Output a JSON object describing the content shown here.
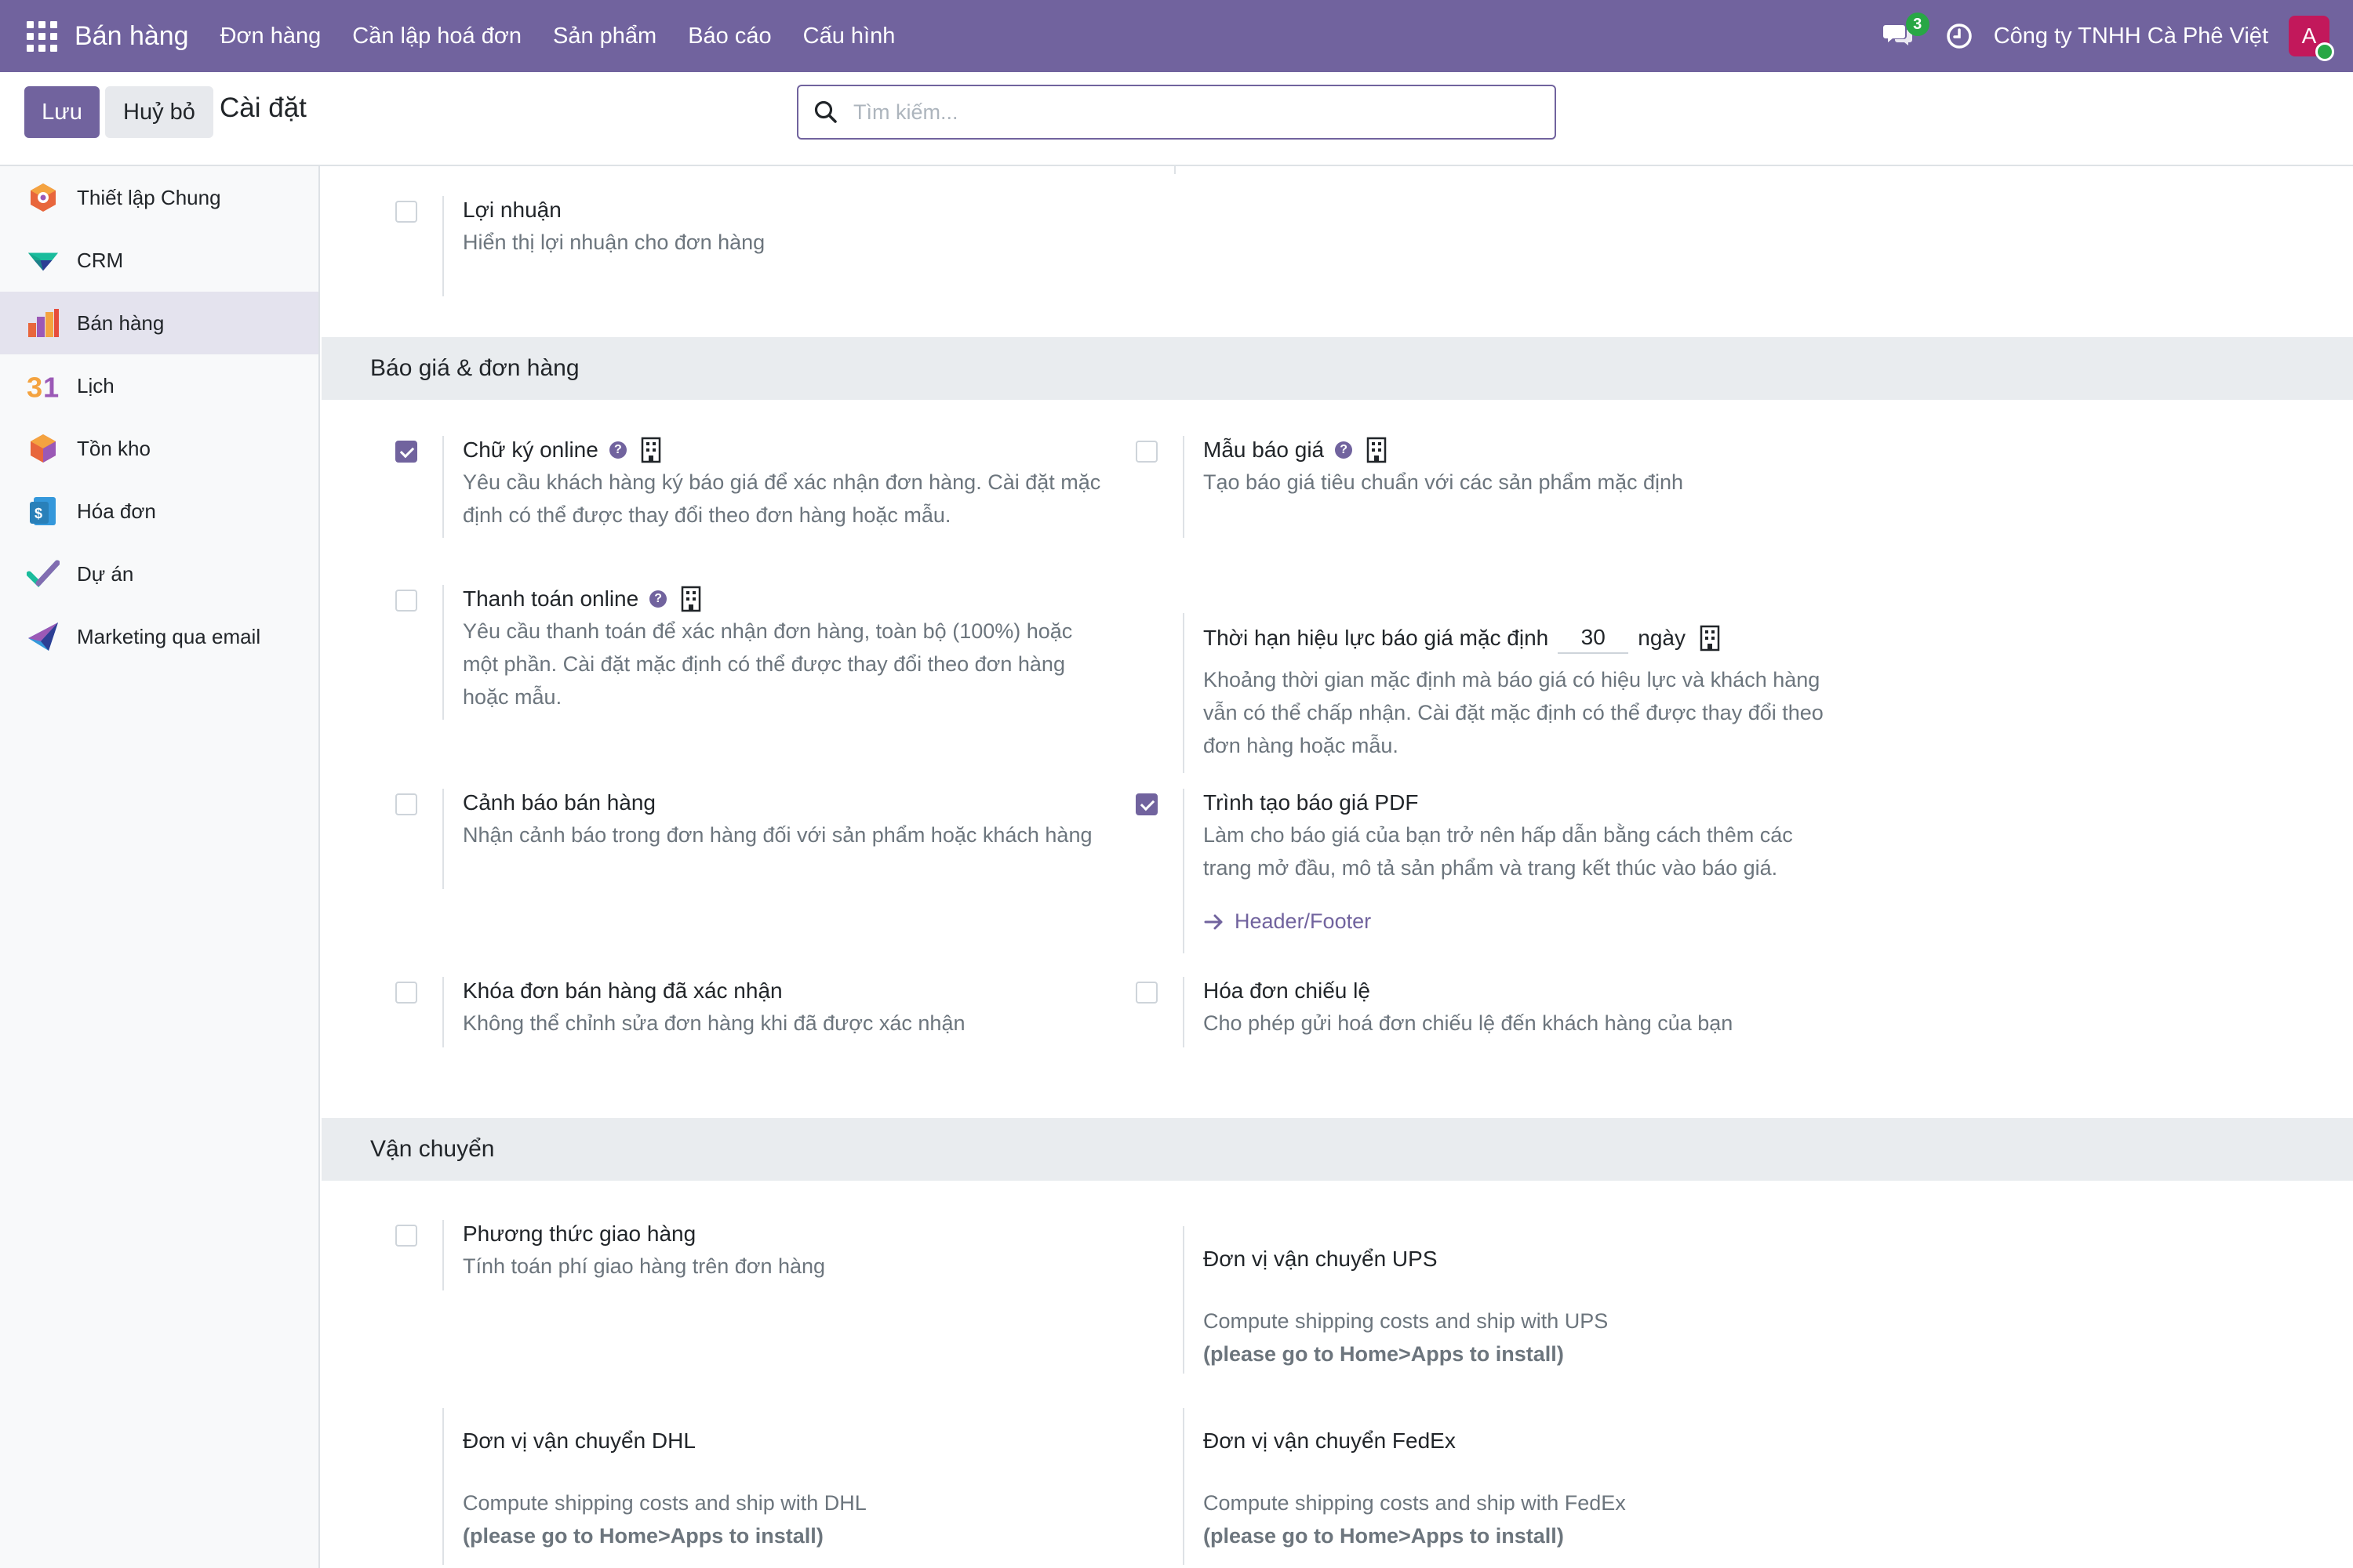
{
  "navbar": {
    "app_name": "Bán hàng",
    "menu": [
      "Đơn hàng",
      "Cần lập hoá đơn",
      "Sản phẩm",
      "Báo cáo",
      "Cấu hình"
    ],
    "chat_count": "3",
    "company": "Công ty TNHH Cà Phê Việt",
    "avatar_letter": "A"
  },
  "control": {
    "save_label": "Lưu",
    "discard_label": "Huỷ bỏ",
    "title": "Cài đặt",
    "search_placeholder": "Tìm kiếm..."
  },
  "sidebar": {
    "items": [
      {
        "label": "Thiết lập Chung",
        "icon": "general-settings-icon"
      },
      {
        "label": "CRM",
        "icon": "crm-icon"
      },
      {
        "label": "Bán hàng",
        "icon": "sales-icon",
        "active": true
      },
      {
        "label": "Lịch",
        "icon": "calendar-icon"
      },
      {
        "label": "Tồn kho",
        "icon": "inventory-icon"
      },
      {
        "label": "Hóa đơn",
        "icon": "invoicing-icon"
      },
      {
        "label": "Dự án",
        "icon": "project-icon"
      },
      {
        "label": "Marketing qua email",
        "icon": "email-marketing-icon"
      }
    ]
  },
  "settings": {
    "margins": {
      "title": "Lợi nhuận",
      "desc": "Hiển thị lợi nhuận cho đơn hàng",
      "checked": false
    },
    "quotations_section": "Báo giá & đơn hàng",
    "online_signature": {
      "title": "Chữ ký online",
      "desc": "Yêu cầu khách hàng ký báo giá để xác nhận đơn hàng. Cài đặt mặc định có thể được thay đổi theo đơn hàng hoặc mẫu.",
      "checked": true
    },
    "quotation_templates": {
      "title": "Mẫu báo giá",
      "desc": "Tạo báo giá tiêu chuẩn với các sản phẩm mặc định",
      "checked": false
    },
    "online_payment": {
      "title": "Thanh toán online",
      "desc": "Yêu cầu thanh toán để xác nhận đơn hàng, toàn bộ (100%) hoặc một phần. Cài đặt mặc định có thể được thay đổi theo đơn hàng hoặc mẫu.",
      "checked": false
    },
    "validity": {
      "title": "Thời hạn hiệu lực báo giá mặc định",
      "value": "30",
      "unit": "ngày",
      "desc": "Khoảng thời gian mặc định mà báo giá có hiệu lực và khách hàng vẫn có thể chấp nhận. Cài đặt mặc định có thể được thay đổi theo đơn hàng hoặc mẫu."
    },
    "sale_warnings": {
      "title": "Cảnh báo bán hàng",
      "desc": "Nhận cảnh báo trong đơn hàng đối với sản phẩm hoặc khách hàng",
      "checked": false
    },
    "pdf_builder": {
      "title": "Trình tạo báo giá PDF",
      "desc": "Làm cho báo giá của bạn trở nên hấp dẫn bằng cách thêm các trang mở đầu, mô tả sản phẩm và trang kết thúc vào báo giá.",
      "checked": true,
      "link": "Header/Footer"
    },
    "lock_orders": {
      "title": "Khóa đơn bán hàng đã xác nhận",
      "desc": "Không thể chỉnh sửa đơn hàng khi đã được xác nhận",
      "checked": false
    },
    "proforma": {
      "title": "Hóa đơn chiếu lệ",
      "desc": "Cho phép gửi hoá đơn chiếu lệ đến khách hàng của bạn",
      "checked": false
    },
    "shipping_section": "Vận chuyển",
    "delivery_methods": {
      "title": "Phương thức giao hàng",
      "desc": "Tính toán phí giao hàng trên đơn hàng",
      "checked": false
    },
    "ups": {
      "title": "Đơn vị vận chuyển UPS",
      "desc": "Compute shipping costs and ship with UPS",
      "install": "(please go to Home>Apps to install)"
    },
    "dhl": {
      "title": "Đơn vị vận chuyển DHL",
      "desc": "Compute shipping costs and ship with DHL",
      "install": "(please go to Home>Apps to install)"
    },
    "fedex": {
      "title": "Đơn vị vận chuyển FedEx",
      "desc": "Compute shipping costs and ship with FedEx",
      "install": "(please go to Home>Apps to install)"
    }
  }
}
